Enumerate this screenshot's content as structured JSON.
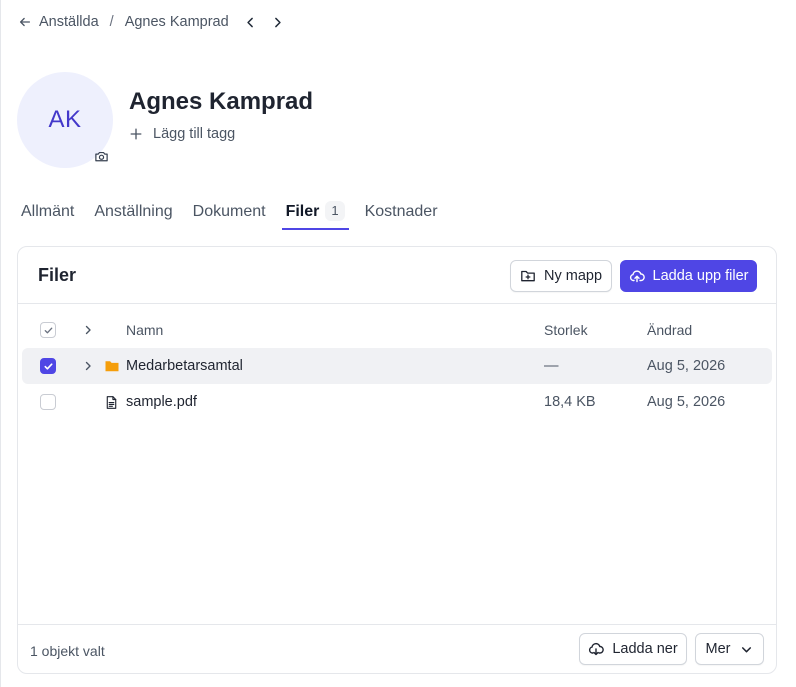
{
  "breadcrumb": {
    "back_label": "Anställda",
    "separator": "/",
    "current": "Agnes Kamprad"
  },
  "profile": {
    "initials": "AK",
    "name": "Agnes Kamprad",
    "add_tag_label": "Lägg till tagg"
  },
  "tabs": [
    {
      "label": "Allmänt"
    },
    {
      "label": "Anställning"
    },
    {
      "label": "Dokument"
    },
    {
      "label": "Filer",
      "count": "1",
      "active": true
    },
    {
      "label": "Kostnader"
    }
  ],
  "files": {
    "title": "Filer",
    "new_folder_label": "Ny mapp",
    "upload_label": "Ladda upp filer",
    "columns": {
      "name": "Namn",
      "size": "Storlek",
      "modified": "Ändrad"
    },
    "rows": [
      {
        "name": "Medarbetarsamtal",
        "type": "folder",
        "size": "—",
        "modified": "Aug 5, 2026",
        "checked": true
      },
      {
        "name": "sample.pdf",
        "type": "file",
        "size": "18,4 KB",
        "modified": "Aug 5, 2026",
        "checked": false
      }
    ],
    "selection_text": "1 objekt valt",
    "download_label": "Ladda ner",
    "more_label": "Mer"
  },
  "colors": {
    "accent": "#4f46e5",
    "avatar_bg": "#eef0fd",
    "folder": "#f59e0b",
    "selected_row": "#f0f1f4"
  },
  "icons": [
    "arrow-left-icon",
    "chevron-left-icon",
    "chevron-right-icon",
    "camera-icon",
    "plus-icon",
    "folder-plus-icon",
    "cloud-upload-icon",
    "folder-icon",
    "file-text-icon",
    "cloud-download-icon",
    "chevron-down-icon",
    "check-icon"
  ]
}
